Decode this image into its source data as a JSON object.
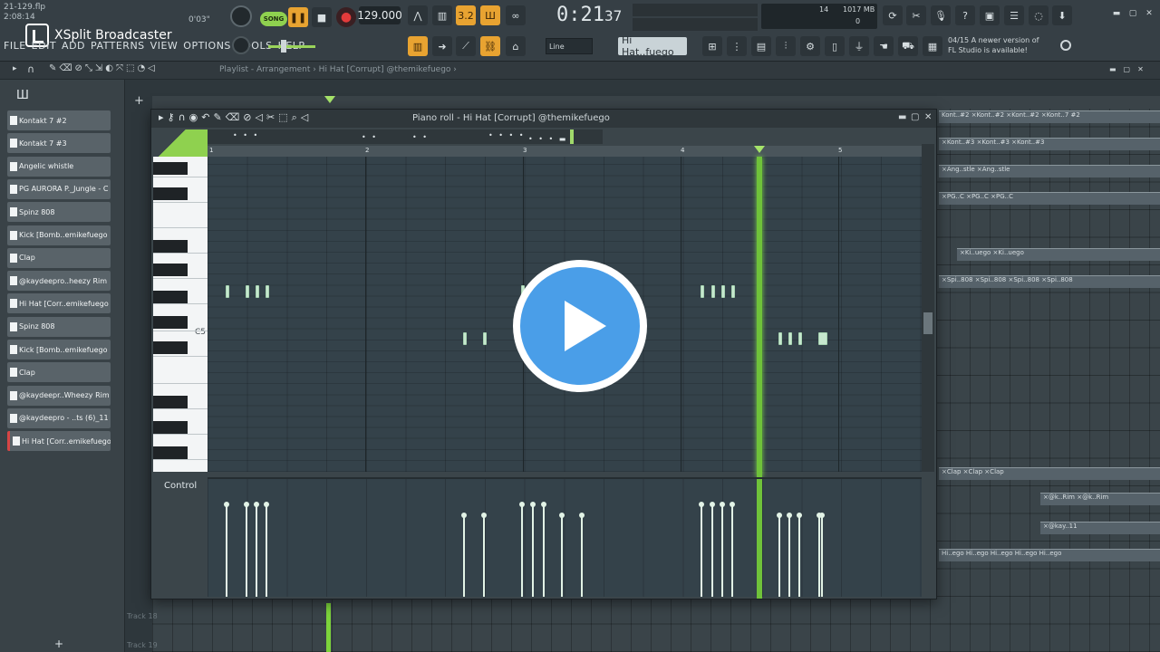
{
  "file": {
    "name": "21-129.flp",
    "elapsed": "2:08:14",
    "position": "0'03\""
  },
  "overlay": {
    "brand": "XSplit Broadcaster"
  },
  "menu": [
    "FILE",
    "EDIT",
    "ADD",
    "PATTERNS",
    "VIEW",
    "OPTIONS",
    "TOOLS",
    "HELP"
  ],
  "transport": {
    "mode_label": "SONG",
    "pause_icon": "pause-icon",
    "stop_icon": "stop-icon",
    "record_icon": "record-icon",
    "tempo": "129.000"
  },
  "clock": {
    "time": "0:21",
    "frames": "37"
  },
  "cpu": {
    "value": "14",
    "memory": "1017 MB",
    "voices": "0"
  },
  "update_notice": {
    "line1": "04/15  A newer version of",
    "line2": "FL Studio is available!"
  },
  "hint_bar": {
    "snap": "Line",
    "channel": "Hi Hat..fuego"
  },
  "playlist": {
    "title": "Playlist - Arrangement › Hi Hat [Corrupt] @themikefuego ›",
    "track_labels": [
      "Track 18",
      "Track 19"
    ],
    "clips": [
      {
        "label": "Kont..#2  ×Kont..#2  ×Kont..#2  ×Kont..7 #2"
      },
      {
        "label": "×Kont..#3  ×Kont..#3  ×Kont..#3"
      },
      {
        "label": "×Ang..stle  ×Ang..stle"
      },
      {
        "label": "×PG..C  ×PG..C  ×PG..C"
      },
      {
        "label": "×Spi..808  ×Spi..808  ×Spi..808  ×Spi..808"
      },
      {
        "label": "×Ki..uego  ×Ki..uego"
      },
      {
        "label": "×Clap  ×Clap  ×Clap"
      },
      {
        "label": "×@k..Rim  ×@k..Rim"
      },
      {
        "label": "×@kay..11"
      },
      {
        "label": "Hi..ego  Hi..ego  Hi..ego  Hi..ego  Hi..ego"
      }
    ]
  },
  "channels": [
    "Kontakt 7 #2",
    "Kontakt 7 #3",
    "Angelic whistle",
    "PG AURORA P._Jungle - C",
    "Spinz 808",
    "Kick [Bomb..emikefuego",
    "Clap",
    "@kaydeepro..heezy Rim",
    "Hi Hat [Corr..emikefuego",
    "Spinz 808",
    "Kick [Bomb..emikefuego",
    "Clap",
    "@kaydeepr..Wheezy Rim",
    "@kaydeepro - ..ts (6)_11",
    "Hi Hat [Corr..emikefuego"
  ],
  "piano_roll": {
    "title": "Piano roll - Hi Hat [Corrupt] @themikefuego",
    "bars": [
      "1",
      "2",
      "3",
      "4",
      "5"
    ],
    "key_label": "C5",
    "control_label": "Control"
  }
}
